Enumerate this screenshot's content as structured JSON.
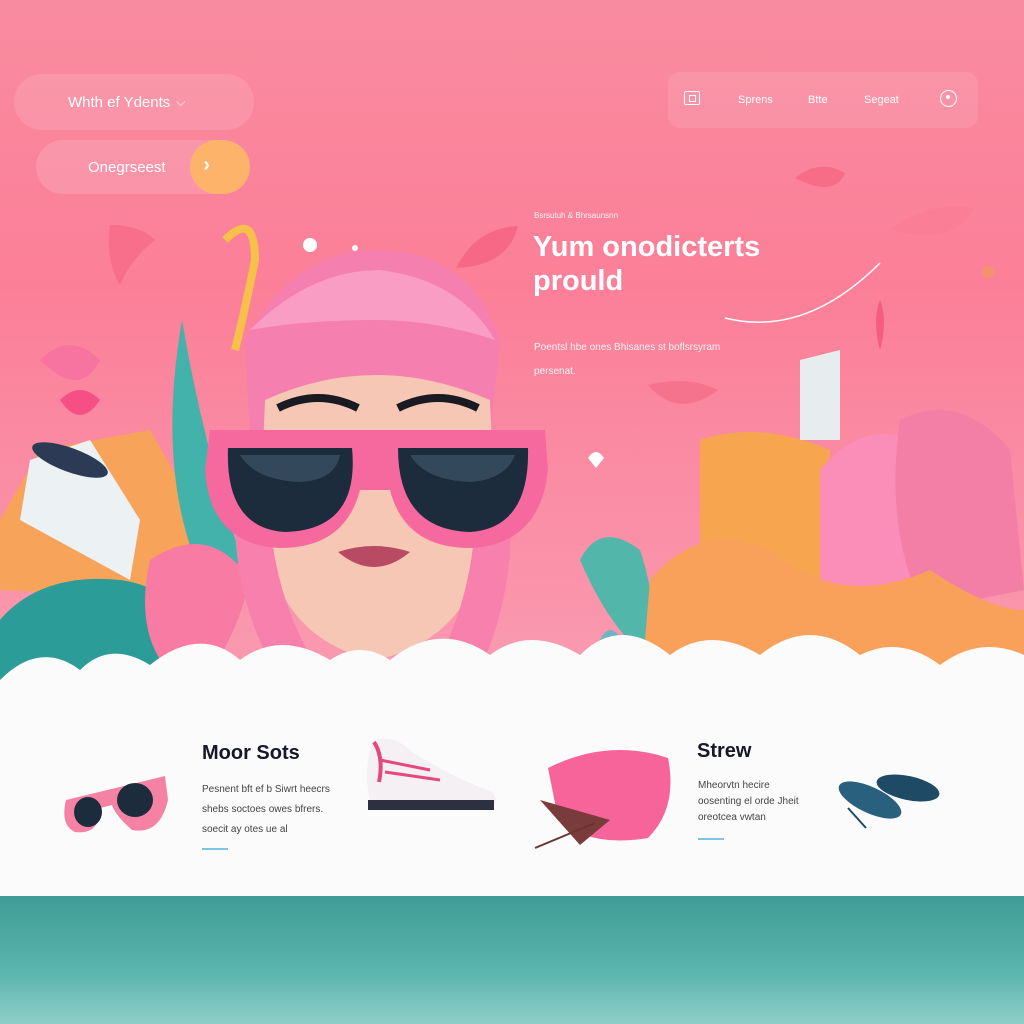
{
  "nav": {
    "dropdown_label": "Whth ef Ydents",
    "cta_label": "Onegrseest",
    "menu": [
      "Sprens",
      "Btte",
      "Segeat"
    ]
  },
  "hero": {
    "eyebrow": "Bsrsutuh & Bhrsaunsnn",
    "headline": "Yum onodicterts prould",
    "subtext": "Poentsl hbe ones Bhisanes st boflsrsyram persenat."
  },
  "products": {
    "left_title": "Moor Sots",
    "left_desc": "Pesnent bft ef b Siwrt heecrs shebs soctoes owes bfrers. soecit ay otes ue al",
    "right_title": "Strew",
    "right_desc": "Mheorvtn hecire oosenting el orde Jheit oreotcea vwtan"
  },
  "colors": {
    "hero_pink": "#fb7f98",
    "teal": "#3e9c96",
    "orange": "#fdb36a",
    "accent_line": "#7dc4e6"
  }
}
